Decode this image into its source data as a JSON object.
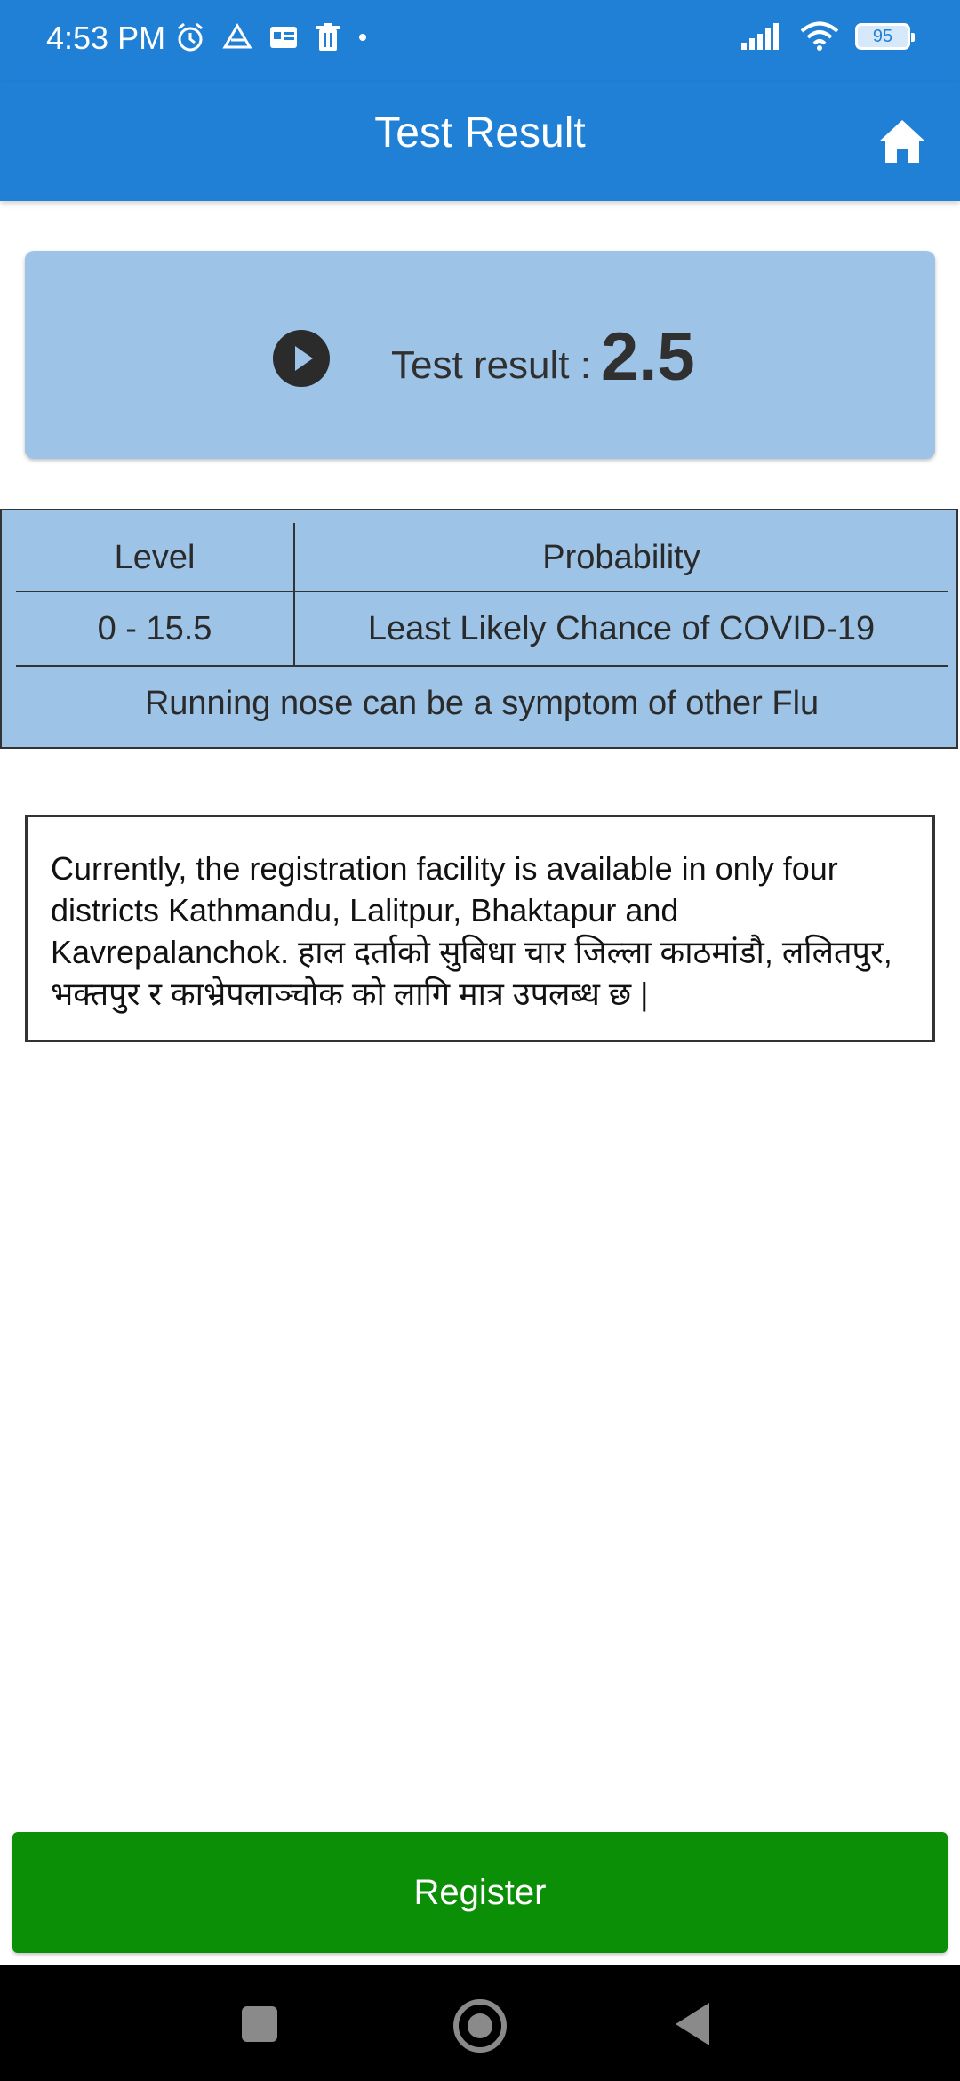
{
  "status_bar": {
    "time": "4:53 PM",
    "battery": "95",
    "icons_left": [
      "alarm-icon",
      "drive-icon",
      "card-icon",
      "trash-icon",
      "dot-icon"
    ],
    "icons_right": [
      "signal-icon",
      "wifi-icon",
      "battery-icon"
    ]
  },
  "app_bar": {
    "title": "Test Result",
    "home_icon": "home-icon",
    "color": "#1f80d6"
  },
  "result_card": {
    "label": "Test result :",
    "value": "2.5",
    "icon": "play-circle-icon",
    "color": "#9dc3e7"
  },
  "table": {
    "header": {
      "level": "Level",
      "probability": "Probability"
    },
    "row": {
      "level": "0 - 15.5",
      "probability": "Least Likely Chance of COVID-19"
    },
    "note": "Running nose can be a symptom of other Flu"
  },
  "info": {
    "text": "Currently, the registration facility is available in only four districts Kathmandu, Lalitpur, Bhaktapur and Kavrepalanchok. हाल दर्ताको सुबिधा चार जिल्ला काठमांडौ, ललितपुर, भक्तपुर र काभ्रेपलाञ्चोक को लागि मात्र उपलब्ध छ |"
  },
  "register_button": {
    "label": "Register",
    "color": "#0a8f06"
  },
  "nav_bar": {
    "icons": [
      "recents-icon",
      "home-circle-icon",
      "back-icon"
    ]
  }
}
